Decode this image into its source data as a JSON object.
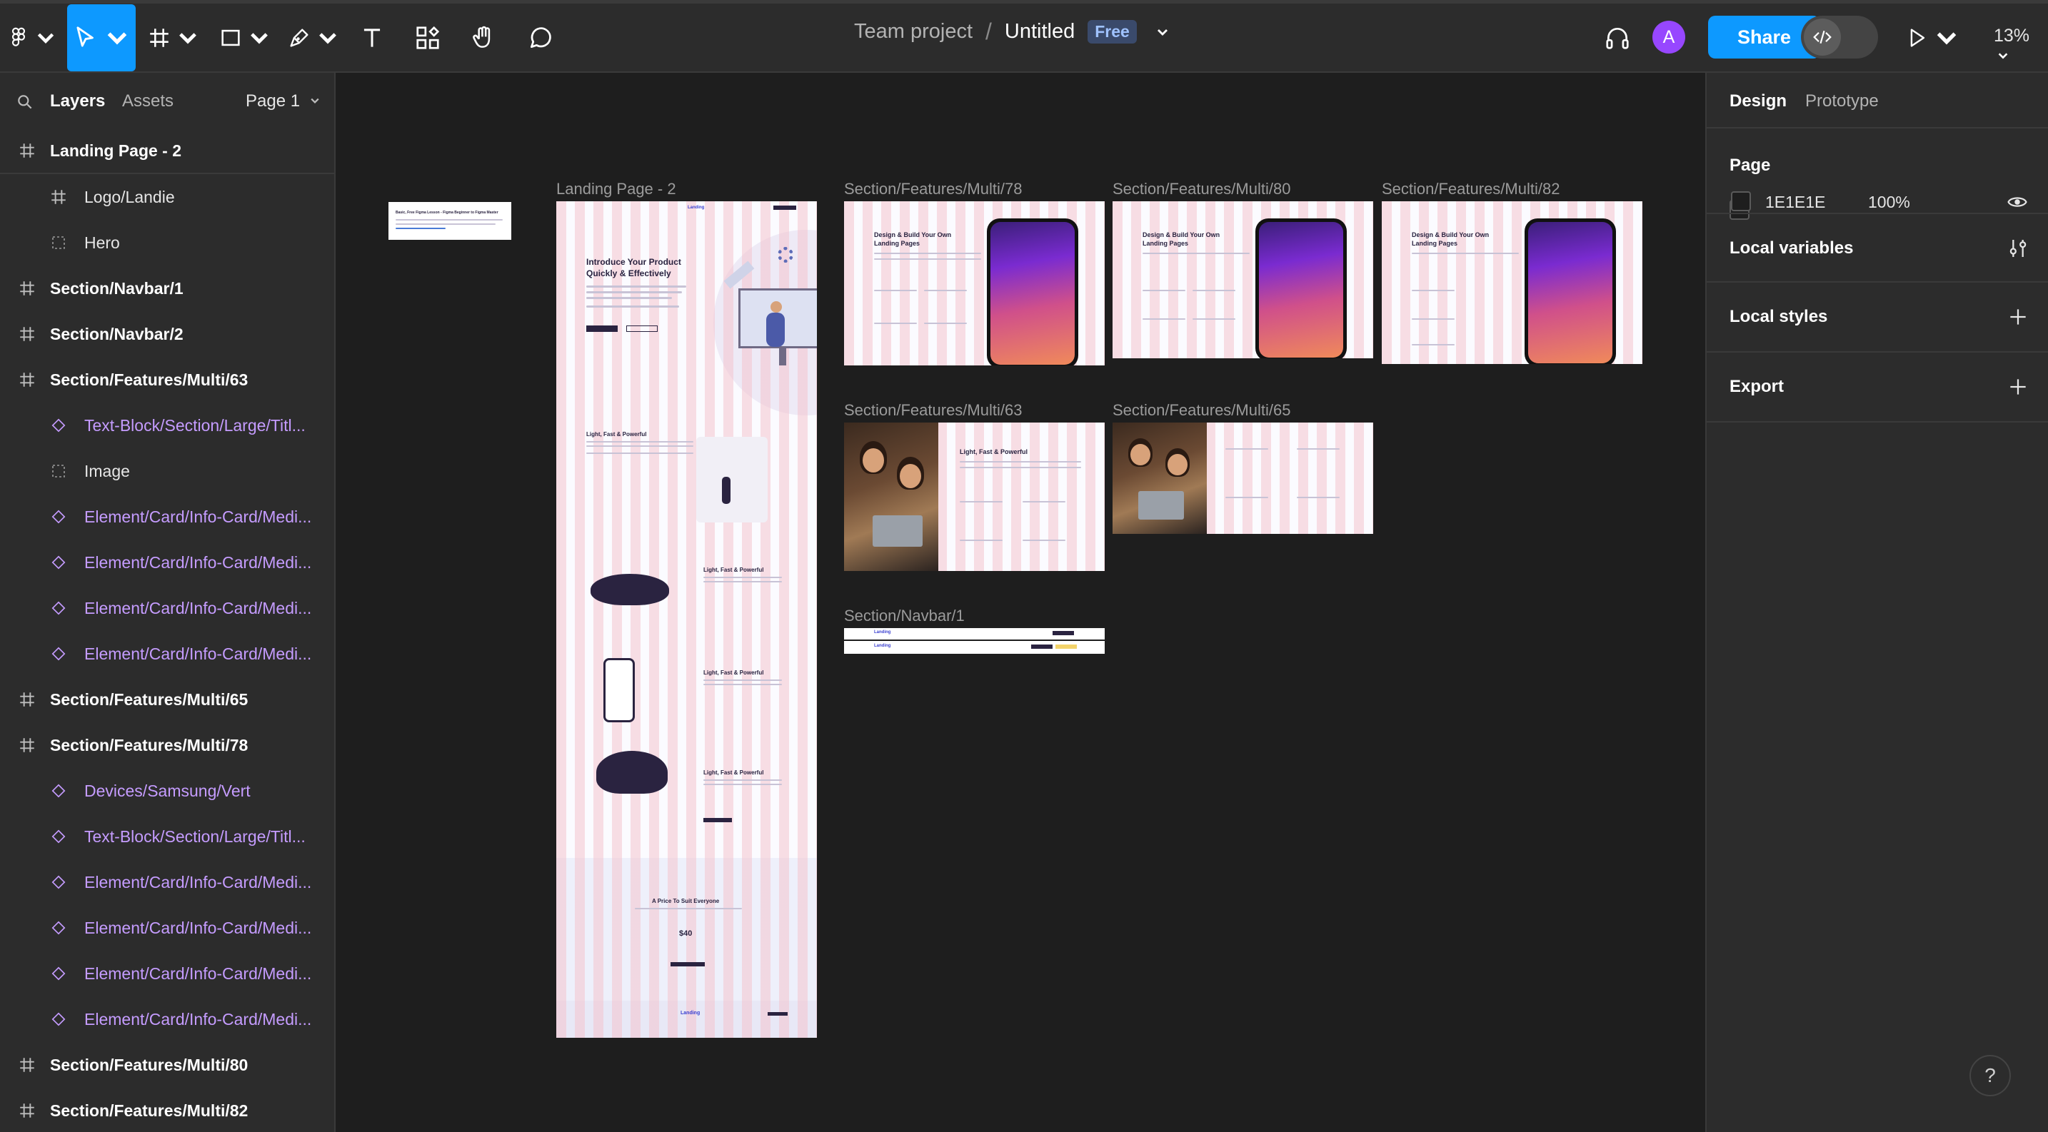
{
  "topbar": {
    "breadcrumb_team": "Team project",
    "breadcrumb_sep": "/",
    "doc_title": "Untitled",
    "plan_badge": "Free",
    "avatar_initial": "A",
    "share_label": "Share",
    "zoom": "13%",
    "tools": [
      "main-menu",
      "move",
      "frame",
      "shape",
      "pen",
      "text",
      "resources",
      "hand",
      "comment"
    ]
  },
  "left": {
    "tabs": {
      "layers": "Layers",
      "assets": "Assets",
      "page": "Page 1"
    },
    "layers": [
      {
        "label": "Landing Page - 2",
        "icon": "frame",
        "level": 0
      },
      {
        "label": "Logo/Landie",
        "icon": "frame",
        "level": 1
      },
      {
        "label": "Hero",
        "icon": "section",
        "level": 1
      },
      {
        "label": "Section/Navbar/1",
        "icon": "frame",
        "level": 0
      },
      {
        "label": "Section/Navbar/2",
        "icon": "frame",
        "level": 0
      },
      {
        "label": "Section/Features/Multi/63",
        "icon": "frame",
        "level": 0
      },
      {
        "label": "Text-Block/Section/Large/Titl...",
        "icon": "instance",
        "level": 1
      },
      {
        "label": "Image",
        "icon": "section",
        "level": 1
      },
      {
        "label": "Element/Card/Info-Card/Medi...",
        "icon": "instance",
        "level": 1
      },
      {
        "label": "Element/Card/Info-Card/Medi...",
        "icon": "instance",
        "level": 1
      },
      {
        "label": "Element/Card/Info-Card/Medi...",
        "icon": "instance",
        "level": 1
      },
      {
        "label": "Element/Card/Info-Card/Medi...",
        "icon": "instance",
        "level": 1
      },
      {
        "label": "Section/Features/Multi/65",
        "icon": "frame",
        "level": 0
      },
      {
        "label": "Section/Features/Multi/78",
        "icon": "frame",
        "level": 0
      },
      {
        "label": "Devices/Samsung/Vert",
        "icon": "instance",
        "level": 1
      },
      {
        "label": "Text-Block/Section/Large/Titl...",
        "icon": "instance",
        "level": 1
      },
      {
        "label": "Element/Card/Info-Card/Medi...",
        "icon": "instance",
        "level": 1
      },
      {
        "label": "Element/Card/Info-Card/Medi...",
        "icon": "instance",
        "level": 1
      },
      {
        "label": "Element/Card/Info-Card/Medi...",
        "icon": "instance",
        "level": 1
      },
      {
        "label": "Element/Card/Info-Card/Medi...",
        "icon": "instance",
        "level": 1
      },
      {
        "label": "Section/Features/Multi/80",
        "icon": "frame",
        "level": 0
      },
      {
        "label": "Section/Features/Multi/82",
        "icon": "frame",
        "level": 0
      }
    ]
  },
  "canvas": {
    "frames": {
      "landing2": "Landing Page - 2",
      "multi78": "Section/Features/Multi/78",
      "multi80": "Section/Features/Multi/80",
      "multi82": "Section/Features/Multi/82",
      "multi63": "Section/Features/Multi/63",
      "multi65": "Section/Features/Multi/65",
      "navbar1": "Section/Navbar/1"
    },
    "mini": {
      "hero_title_1": "Introduce Your Product",
      "hero_title_2": "Quickly & Effectively",
      "feature_title": "Light, Fast & Powerful",
      "feature_design_1": "Design & Build Your Own",
      "feature_design_2": "Landing Pages",
      "price_title": "A Price To Suit Everyone",
      "price_value": "$40",
      "brand": "Landing",
      "note_title": "Basic, Free Figma Lesson - Figma Beginner to Figma Master"
    }
  },
  "right": {
    "tabs": {
      "design": "Design",
      "prototype": "Prototype"
    },
    "page_title": "Page",
    "page_color": "1E1E1E",
    "page_opacity": "100%",
    "local_variables": "Local variables",
    "local_styles": "Local styles",
    "export": "Export",
    "help": "?"
  },
  "colors": {
    "accent": "#0d99ff",
    "panel": "#2c2c2c",
    "canvas": "#1e1e1e",
    "instance_purple": "#c59cff",
    "badge": "#3a4a6b",
    "avatar": "#9747ff"
  }
}
